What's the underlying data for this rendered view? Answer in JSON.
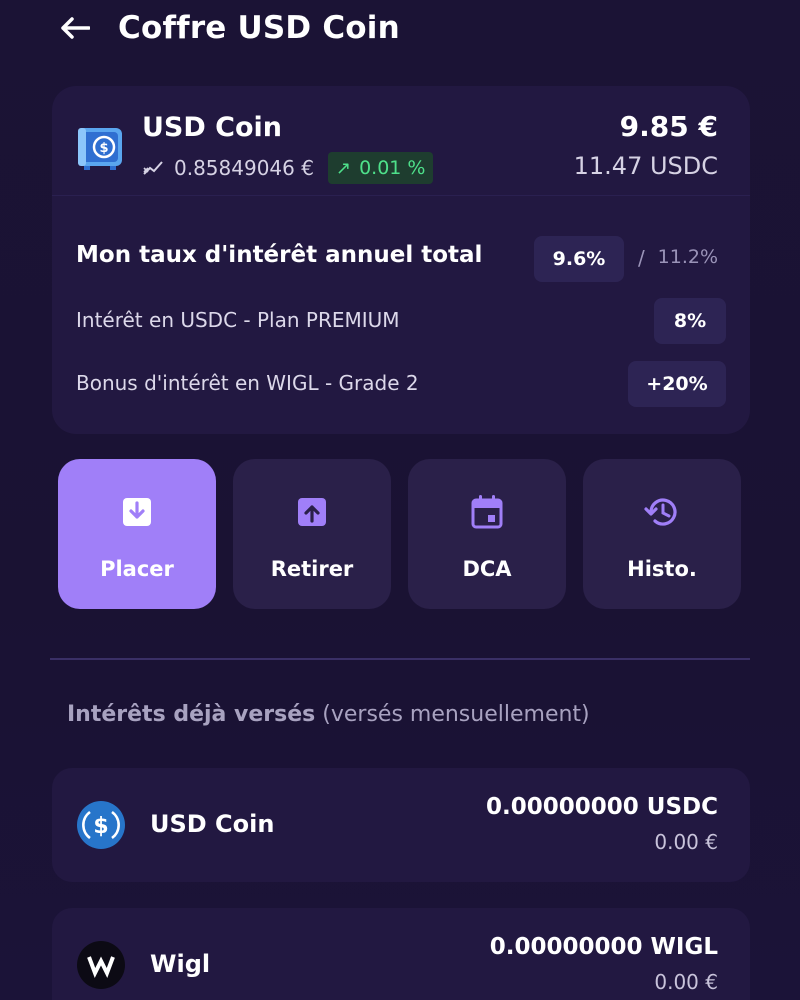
{
  "header": {
    "title": "Coffre USD Coin"
  },
  "vault": {
    "coin_name": "USD Coin",
    "price": "0.85849046 €",
    "change": "0.01 %",
    "balance_eur": "9.85 €",
    "balance_usdc": "11.47 USDC"
  },
  "rates": {
    "title": "Mon taux d'intérêt annuel total",
    "current": "9.6%",
    "separator": "/",
    "max": "11.2%",
    "rows": [
      {
        "label": "Intérêt en USDC - Plan PREMIUM",
        "value": "8%"
      },
      {
        "label": "Bonus d'intérêt en WIGL - Grade 2",
        "value": "+20%"
      }
    ]
  },
  "actions": [
    {
      "label": "Placer",
      "icon": "deposit-icon"
    },
    {
      "label": "Retirer",
      "icon": "withdraw-icon"
    },
    {
      "label": "DCA",
      "icon": "calendar-icon"
    },
    {
      "label": "Histo.",
      "icon": "history-icon"
    }
  ],
  "paid_interest": {
    "title_bold": "Intérêts déjà versés",
    "title_sub": "(versés mensuellement)",
    "items": [
      {
        "name": "USD Coin",
        "amount": "0.00000000 USDC",
        "eur": "0.00 €"
      },
      {
        "name": "Wigl",
        "amount": "0.00000000 WIGL",
        "eur": "0.00 €"
      }
    ]
  },
  "colors": {
    "accent": "#a07ff8",
    "card": "#221841",
    "background": "#1a1233",
    "positive": "#4ee08a"
  }
}
